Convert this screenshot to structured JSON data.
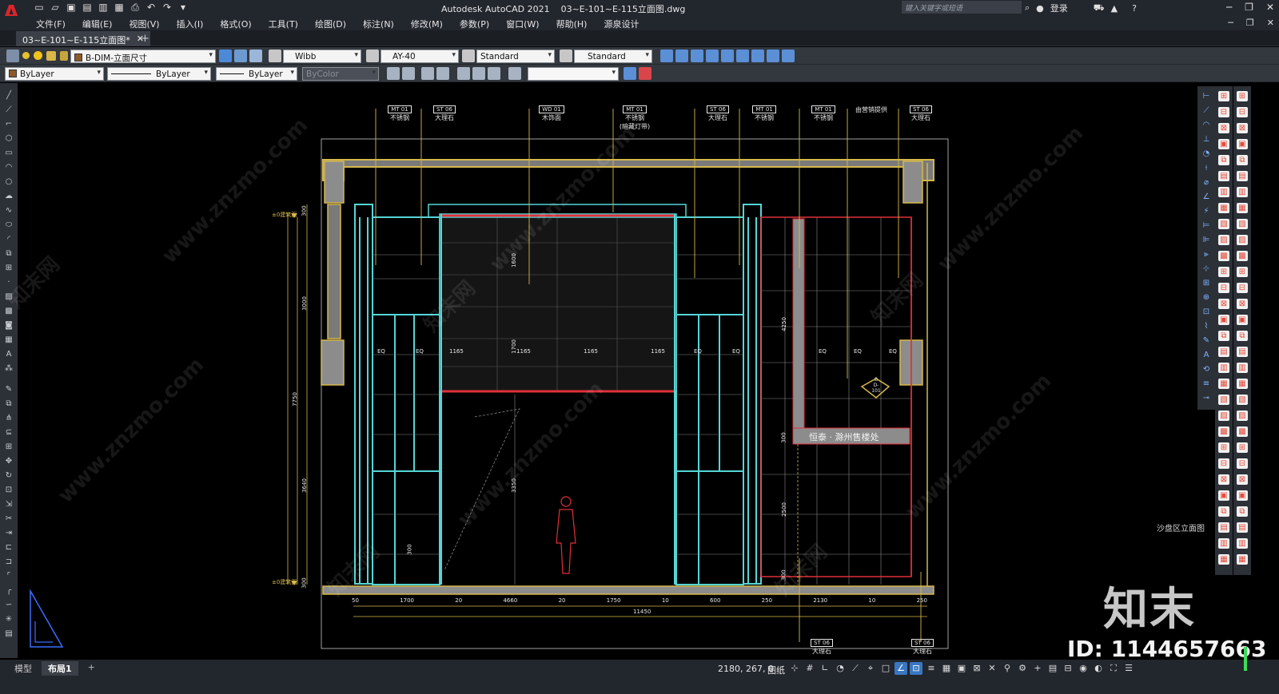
{
  "app": {
    "name": "Autodesk AutoCAD 2021",
    "filename": "03~E-101~E-115立面图.dwg",
    "search_placeholder": "键入关键字或短语",
    "login": "登录"
  },
  "menu": [
    "文件(F)",
    "编辑(E)",
    "视图(V)",
    "插入(I)",
    "格式(O)",
    "工具(T)",
    "绘图(D)",
    "标注(N)",
    "修改(M)",
    "参数(P)",
    "窗口(W)",
    "帮助(H)",
    "源泉设计"
  ],
  "document_tab": "03~E-101~E-115立面图*",
  "toolbar1": {
    "layer": "B-DIM-立面尺寸",
    "text_style": "Wibb",
    "dim_style": "AY-40",
    "table_style": "Standard",
    "mleader_style": "Standard"
  },
  "toolbar2": {
    "color": "ByLayer",
    "linetype": "ByLayer",
    "lineweight": "ByLayer",
    "plotstyle": "ByColor",
    "layer_input": ""
  },
  "drawing": {
    "callouts_top": [
      {
        "code": "MT",
        "num": "01",
        "text": "不锈钢"
      },
      {
        "code": "ST",
        "num": "06",
        "text": "大理石"
      },
      {
        "code": "WD",
        "num": "01",
        "text": "木饰面"
      },
      {
        "code": "MT",
        "num": "01",
        "text": "不锈钢",
        "text2": "(暗藏灯带)"
      },
      {
        "code": "ST",
        "num": "06",
        "text": "大理石"
      },
      {
        "code": "MT",
        "num": "01",
        "text": "不锈钢"
      },
      {
        "code": "MT",
        "num": "01",
        "text": "不锈钢"
      },
      {
        "code": "",
        "num": "",
        "text": "由营销提供"
      },
      {
        "code": "ST",
        "num": "06",
        "text": "大理石"
      }
    ],
    "callouts_bottom": [
      {
        "code": "ST",
        "num": "06",
        "text": "大理石"
      },
      {
        "code": "ST",
        "num": "06",
        "text": "大理石"
      }
    ],
    "sign_text": "恒泰 · 滁州售楼处",
    "section_mark": {
      "top": "B",
      "bottom": "D-101"
    },
    "dims_bottom": [
      "50",
      "1700",
      "20",
      "4660",
      "20",
      "1750",
      "10",
      "600",
      "250",
      "2130",
      "10",
      "250"
    ],
    "total_dim": "11450",
    "dims_left": [
      "300",
      "3000",
      "7750",
      "3640",
      "300"
    ],
    "level_marks": [
      "±0建筑面",
      "±0建筑面"
    ],
    "dims_mid": [
      "1165",
      "1165",
      "1165",
      "1165",
      "1165"
    ],
    "eq_label": "EQ",
    "vertical_dims": [
      "1600",
      "1700",
      "3350",
      "4250",
      "2500",
      "300",
      "300",
      "300"
    ],
    "side_label": "沙盘区立面图"
  },
  "watermark": {
    "brand": "知末",
    "id": "ID: 1144657663",
    "site": "www.znzmo.com",
    "cn": "知末网"
  },
  "status": {
    "tabs": [
      "模型",
      "布局1"
    ],
    "coords": "2180, 267, 0",
    "space": "图纸"
  },
  "colors": {
    "accent_red": "#d9262c",
    "cyan": "#54d6d6",
    "gold": "#d6b84b",
    "red": "#e0303a",
    "gray_fill": "#8c8c8c"
  }
}
